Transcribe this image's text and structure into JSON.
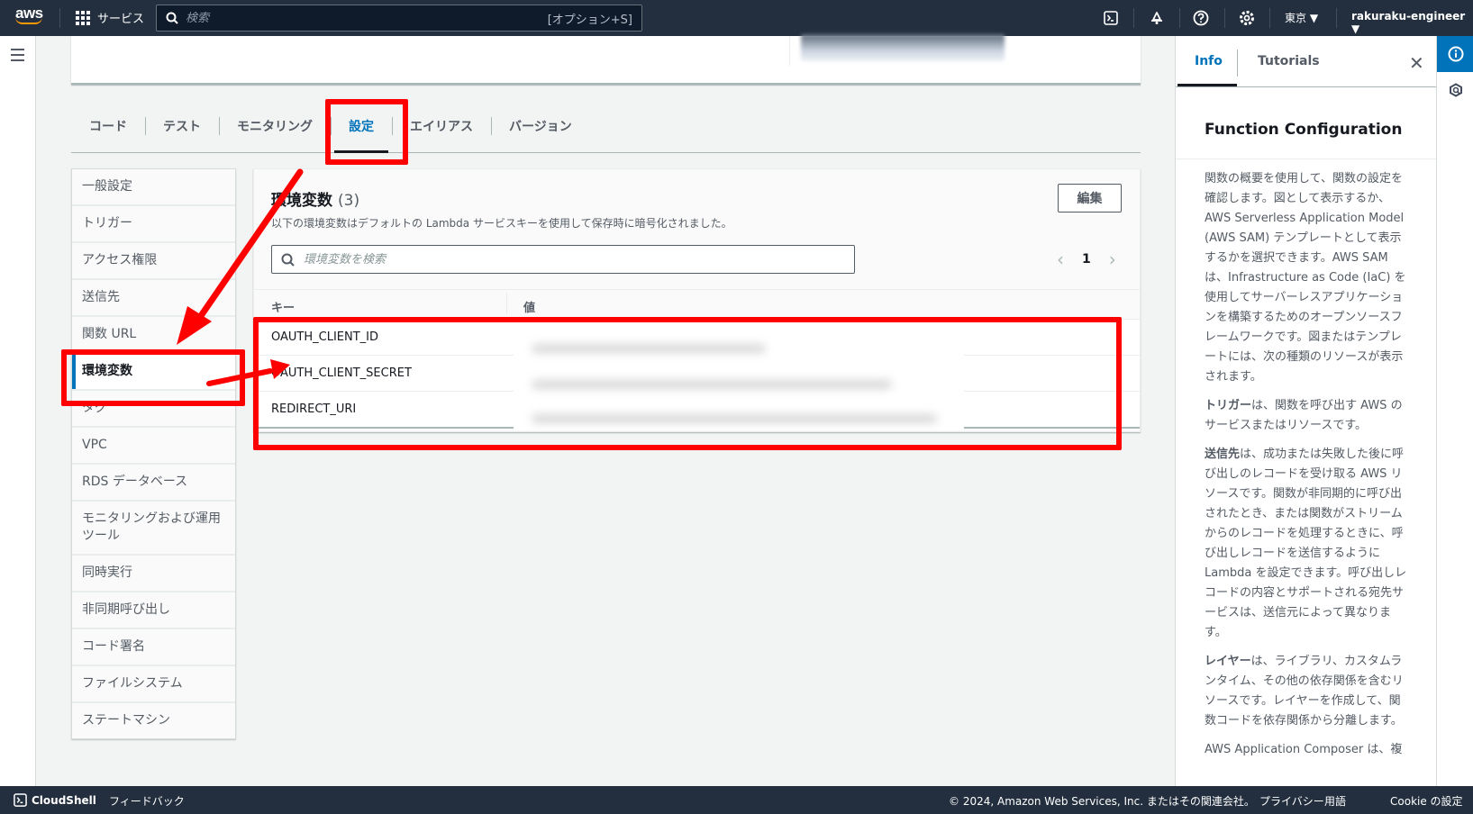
{
  "topnav": {
    "logo": "aws",
    "services_label": "サービス",
    "search_placeholder": "検索",
    "search_shortcut": "[オプション+S]",
    "region": "東京 ▼",
    "user": "rakuraku-engineer ▼",
    "icons": [
      "cloudshell-icon",
      "notifications-icon",
      "help-icon",
      "settings-icon"
    ]
  },
  "tabs": [
    {
      "label": "コード",
      "active": false
    },
    {
      "label": "テスト",
      "active": false
    },
    {
      "label": "モニタリング",
      "active": false
    },
    {
      "label": "設定",
      "active": true
    },
    {
      "label": "エイリアス",
      "active": false
    },
    {
      "label": "バージョン",
      "active": false
    }
  ],
  "side_menu": [
    {
      "label": "一般設定",
      "active": false
    },
    {
      "label": "トリガー",
      "active": false
    },
    {
      "label": "アクセス権限",
      "active": false
    },
    {
      "label": "送信先",
      "active": false
    },
    {
      "label": "関数 URL",
      "active": false
    },
    {
      "label": "環境変数",
      "active": true
    },
    {
      "label": "タグ",
      "active": false
    },
    {
      "label": "VPC",
      "active": false
    },
    {
      "label": "RDS データベース",
      "active": false
    },
    {
      "label": "モニタリングおよび運用ツール",
      "active": false
    },
    {
      "label": "同時実行",
      "active": false
    },
    {
      "label": "非同期呼び出し",
      "active": false
    },
    {
      "label": "コード署名",
      "active": false
    },
    {
      "label": "ファイルシステム",
      "active": false
    },
    {
      "label": "ステートマシン",
      "active": false
    }
  ],
  "env": {
    "title": "環境変数",
    "count": "(3)",
    "description": "以下の環境変数はデフォルトの Lambda サービスキーを使用して保存時に暗号化されました。",
    "edit_label": "編集",
    "search_placeholder": "環境変数を検索",
    "page": "1",
    "prev": "‹",
    "next": "›",
    "columns": {
      "key": "キー",
      "value": "値"
    },
    "rows": [
      {
        "key": "OAUTH_CLIENT_ID",
        "value": ""
      },
      {
        "key": "OAUTH_CLIENT_SECRET",
        "value": ""
      },
      {
        "key": "REDIRECT_URI",
        "value": ""
      }
    ]
  },
  "help": {
    "tab_info": "Info",
    "tab_tutorials": "Tutorials",
    "close": "✕",
    "title": "Function Configuration",
    "p1": "関数の概要を使用して、関数の設定を確認します。図として表示するか、AWS Serverless Application Model (AWS SAM) テンプレートとして表示するかを選択できます。AWS SAM は、Infrastructure as Code (IaC) を使用してサーバーレスアプリケーションを構築するためのオープンソースフレームワークです。図またはテンプレートには、次の種類のリソースが表示されます。",
    "p2_bold": "トリガー",
    "p2": "は、関数を呼び出す AWS のサービスまたはリソースです。",
    "p3_bold": "送信先",
    "p3": "は、成功または失敗した後に呼び出しのレコードを受け取る AWS リソースです。関数が非同期的に呼び出されたとき、または関数がストリームからのレコードを処理するときに、呼び出しレコードを送信するように Lambda を設定できます。呼び出しレコードの内容とサポートされる宛先サービスは、送信元によって異なります。",
    "p4_bold": "レイヤー",
    "p4": "は、ライブラリ、カスタムランタイム、その他の依存関係を含むリソースです。レイヤーを作成して、関数コードを依存関係から分離します。",
    "p5": "AWS Application Composer は、複"
  },
  "footer": {
    "cloudshell": "CloudShell",
    "feedback": "フィードバック",
    "copyright": "© 2024, Amazon Web Services, Inc. またはその関連会社。",
    "privacy": "プライバシー",
    "terms": "用語",
    "cookie": "Cookie の設定"
  },
  "colors": {
    "accent": "#0073bb",
    "nav_bg": "#232f3e",
    "annotation": "#ff0000"
  }
}
